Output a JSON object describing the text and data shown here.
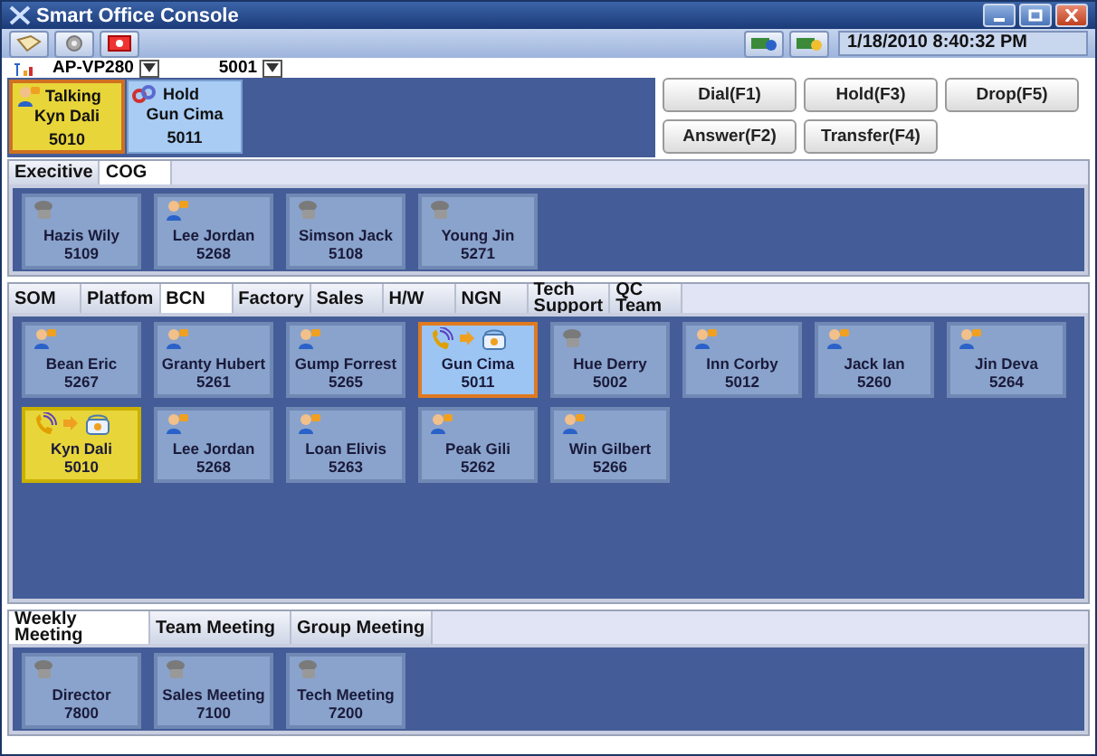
{
  "window": {
    "title": "Smart Office Console"
  },
  "status_bar": {
    "datetime": "1/18/2010 8:40:32 PM"
  },
  "device": {
    "model": "AP-VP280",
    "extension": "5001"
  },
  "calls": [
    {
      "kind": "talking",
      "label": "Talking",
      "name": "Kyn Dali",
      "number": "5010"
    },
    {
      "kind": "hold",
      "label": "Hold",
      "name": "Gun Cima",
      "number": "5011"
    }
  ],
  "call_buttons": [
    "Dial(F1)",
    "Hold(F3)",
    "Drop(F5)",
    "Answer(F2)",
    "Transfer(F4)"
  ],
  "groups": [
    {
      "tabs": [
        {
          "label": "Execitive",
          "selected": false
        },
        {
          "label": "COG",
          "selected": true
        }
      ],
      "members": [
        {
          "name": "Hazis Wily",
          "number": "5109",
          "kind": "offline"
        },
        {
          "name": "Lee Jordan",
          "number": "5268",
          "kind": "available"
        },
        {
          "name": "Simson Jack",
          "number": "5108",
          "kind": "offline"
        },
        {
          "name": "Young Jin",
          "number": "5271",
          "kind": "offline"
        }
      ]
    },
    {
      "tabs": [
        {
          "label": "SOM",
          "selected": false
        },
        {
          "label": "Platfom",
          "selected": false
        },
        {
          "label": "BCN",
          "selected": true
        },
        {
          "label": "Factory",
          "selected": false
        },
        {
          "label": "Sales",
          "selected": false
        },
        {
          "label": "H/W",
          "selected": false
        },
        {
          "label": "NGN",
          "selected": false
        },
        {
          "label": "Tech Support",
          "selected": false
        },
        {
          "label": "QC Team",
          "selected": false
        }
      ],
      "members": [
        {
          "name": "Bean Eric",
          "number": "5267",
          "kind": "available"
        },
        {
          "name": "Granty Hubert",
          "number": "5261",
          "kind": "available"
        },
        {
          "name": "Gump Forrest",
          "number": "5265",
          "kind": "available"
        },
        {
          "name": "Gun Cima",
          "number": "5011",
          "kind": "hold"
        },
        {
          "name": "Hue Derry",
          "number": "5002",
          "kind": "offline"
        },
        {
          "name": "Inn Corby",
          "number": "5012",
          "kind": "available"
        },
        {
          "name": "Jack Ian",
          "number": "5260",
          "kind": "available"
        },
        {
          "name": "Jin Deva",
          "number": "5264",
          "kind": "available"
        },
        {
          "name": "Kyn Dali",
          "number": "5010",
          "kind": "talking"
        },
        {
          "name": "Lee Jordan",
          "number": "5268",
          "kind": "available"
        },
        {
          "name": "Loan Elivis",
          "number": "5263",
          "kind": "available"
        },
        {
          "name": "Peak Gili",
          "number": "5262",
          "kind": "available"
        },
        {
          "name": "Win Gilbert",
          "number": "5266",
          "kind": "available"
        }
      ]
    },
    {
      "tabs": [
        {
          "label": "Weekly Meeting",
          "selected": true
        },
        {
          "label": "Team Meeting",
          "selected": false
        },
        {
          "label": "Group Meeting",
          "selected": false
        }
      ],
      "members": [
        {
          "name": "Director",
          "number": "7800",
          "kind": "offline"
        },
        {
          "name": "Sales Meeting",
          "number": "7100",
          "kind": "offline"
        },
        {
          "name": "Tech Meeting",
          "number": "7200",
          "kind": "offline"
        }
      ]
    }
  ]
}
